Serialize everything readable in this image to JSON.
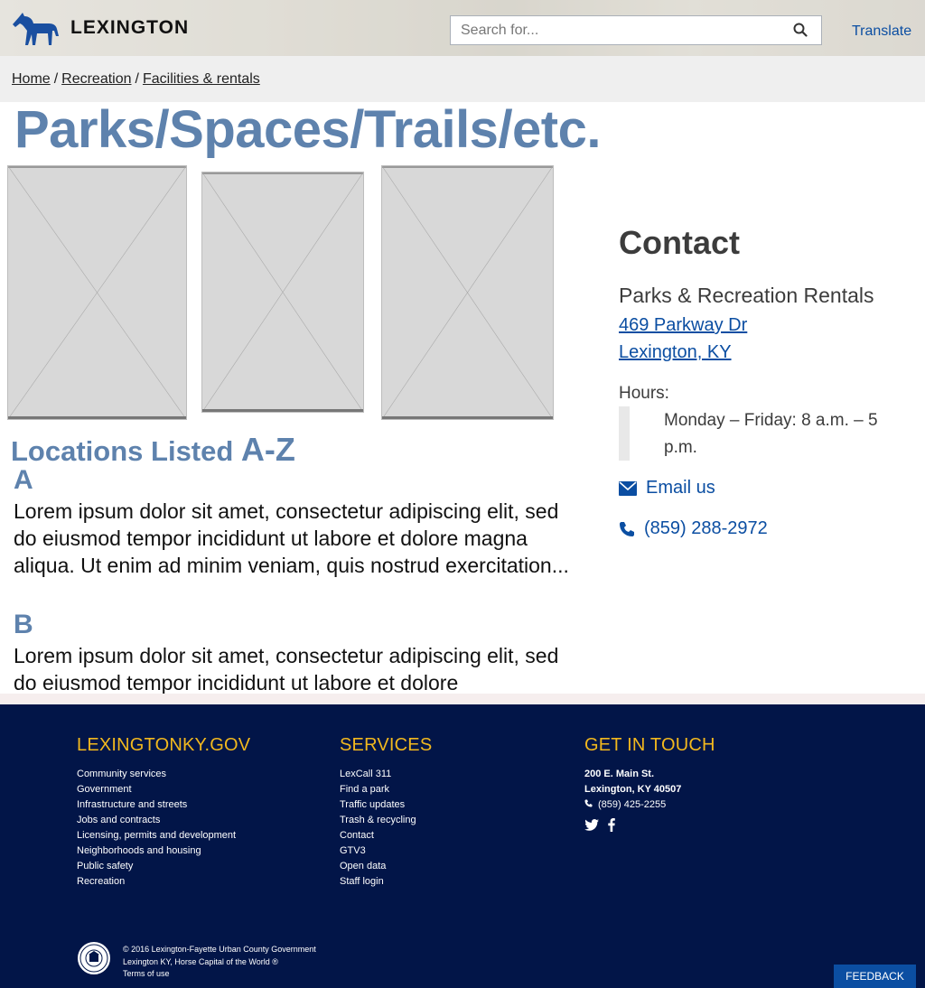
{
  "header": {
    "logo_text": "LEXINGTON",
    "search_placeholder": "Search for...",
    "translate_label": "Translate"
  },
  "breadcrumb": {
    "items": [
      "Home",
      "Recreation",
      "Facilities & rentals"
    ],
    "separator": "/"
  },
  "page_title": "Parks/Spaces/Trails/etc.",
  "locations": {
    "heading": "Locations Listed ",
    "heading_range": "A-Z",
    "sections": [
      {
        "letter": "A",
        "text": "Lorem ipsum dolor sit amet, consectetur adipiscing elit, sed do eiusmod tempor incididunt ut labore et dolore magna aliqua. Ut enim ad minim veniam, quis nostrud exercitation..."
      },
      {
        "letter": "B",
        "text": "Lorem ipsum dolor sit amet, consectetur adipiscing elit, sed do eiusmod tempor incididunt ut labore et dolore"
      }
    ]
  },
  "contact": {
    "title": "Contact",
    "org": "Parks & Recreation Rentals",
    "address_line1": "469 Parkway Dr",
    "address_line2": "Lexington, KY",
    "hours_label": "Hours:",
    "hours": "Monday – Friday: 8 a.m. – 5 p.m.",
    "email_label": "Email us",
    "phone": "(859) 288-2972"
  },
  "footer": {
    "col1": {
      "title": "LEXINGTONKY.GOV",
      "links": [
        "Community services",
        "Government",
        "Infrastructure and streets",
        "Jobs and contracts",
        "Licensing, permits and development",
        "Neighborhoods and housing",
        "Public safety",
        "Recreation"
      ]
    },
    "col2": {
      "title": "SERVICES",
      "links": [
        "LexCall 311",
        "Find a park",
        "Traffic updates",
        "Trash & recycling",
        "Contact",
        "GTV3",
        "Open data",
        "Staff login"
      ]
    },
    "col3": {
      "title": "GET IN TOUCH",
      "address1": "200 E. Main St.",
      "address2": "Lexington, KY 40507",
      "phone": "(859) 425-2255"
    },
    "copyright1": "© 2016 Lexington-Fayette Urban County Government",
    "copyright2": "Lexington KY, Horse Capital of the World ®",
    "terms": "Terms of use",
    "feedback_label": "FEEDBACK"
  },
  "colors": {
    "title_blue": "#5e82ad",
    "link_blue": "#0b4ea2",
    "footer_navy": "#021548",
    "footer_gold": "#f2b81e"
  }
}
